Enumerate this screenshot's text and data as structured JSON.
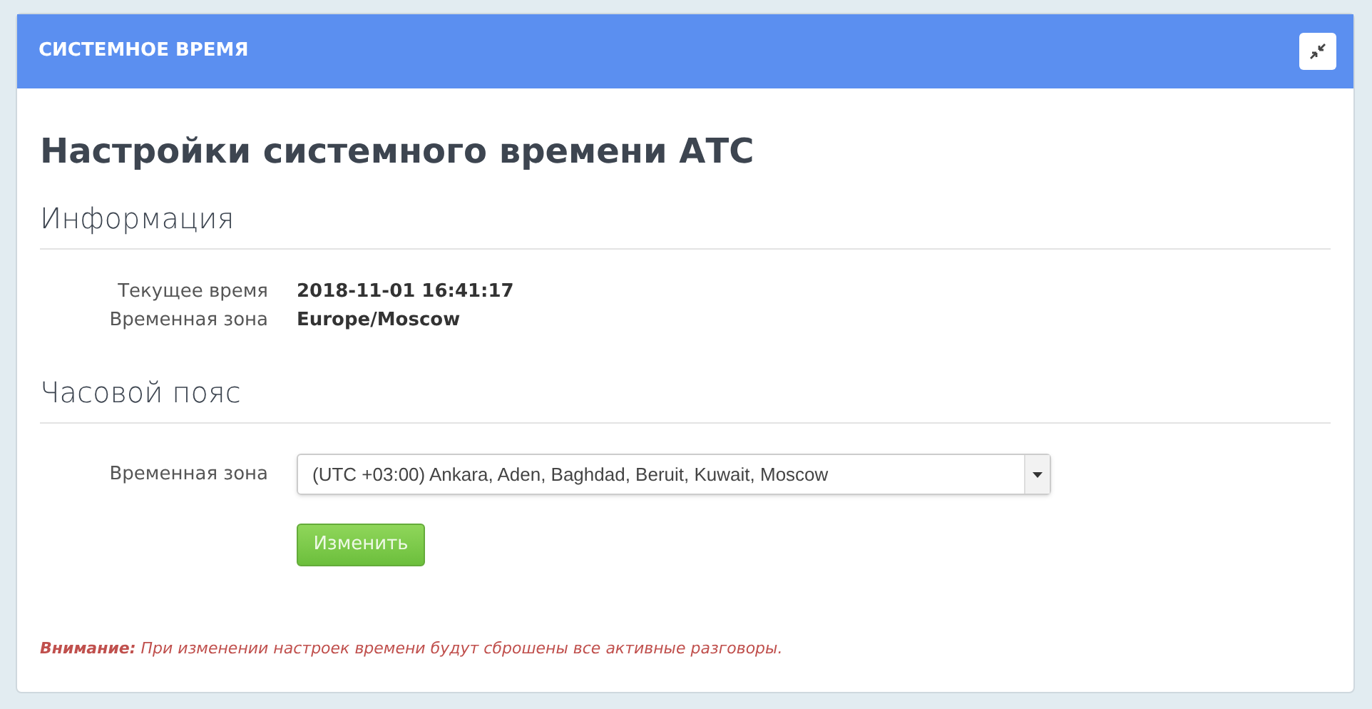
{
  "panel": {
    "title": "СИСТЕМНОЕ ВРЕМЯ"
  },
  "heading": "Настройки системного времени АТС",
  "info": {
    "title": "Информация",
    "rows": [
      {
        "label": "Текущее время",
        "value": "2018-11-01 16:41:17"
      },
      {
        "label": "Временная зона",
        "value": "Europe/Moscow"
      }
    ]
  },
  "timezone": {
    "title": "Часовой пояс",
    "label": "Временная зона",
    "value": "(UTC +03:00) Ankara, Aden, Baghdad, Beruit, Kuwait, Moscow",
    "button": "Изменить"
  },
  "warning": "**Внимание:** При изменении настроек времени будут сброшены все активные разговоры."
}
